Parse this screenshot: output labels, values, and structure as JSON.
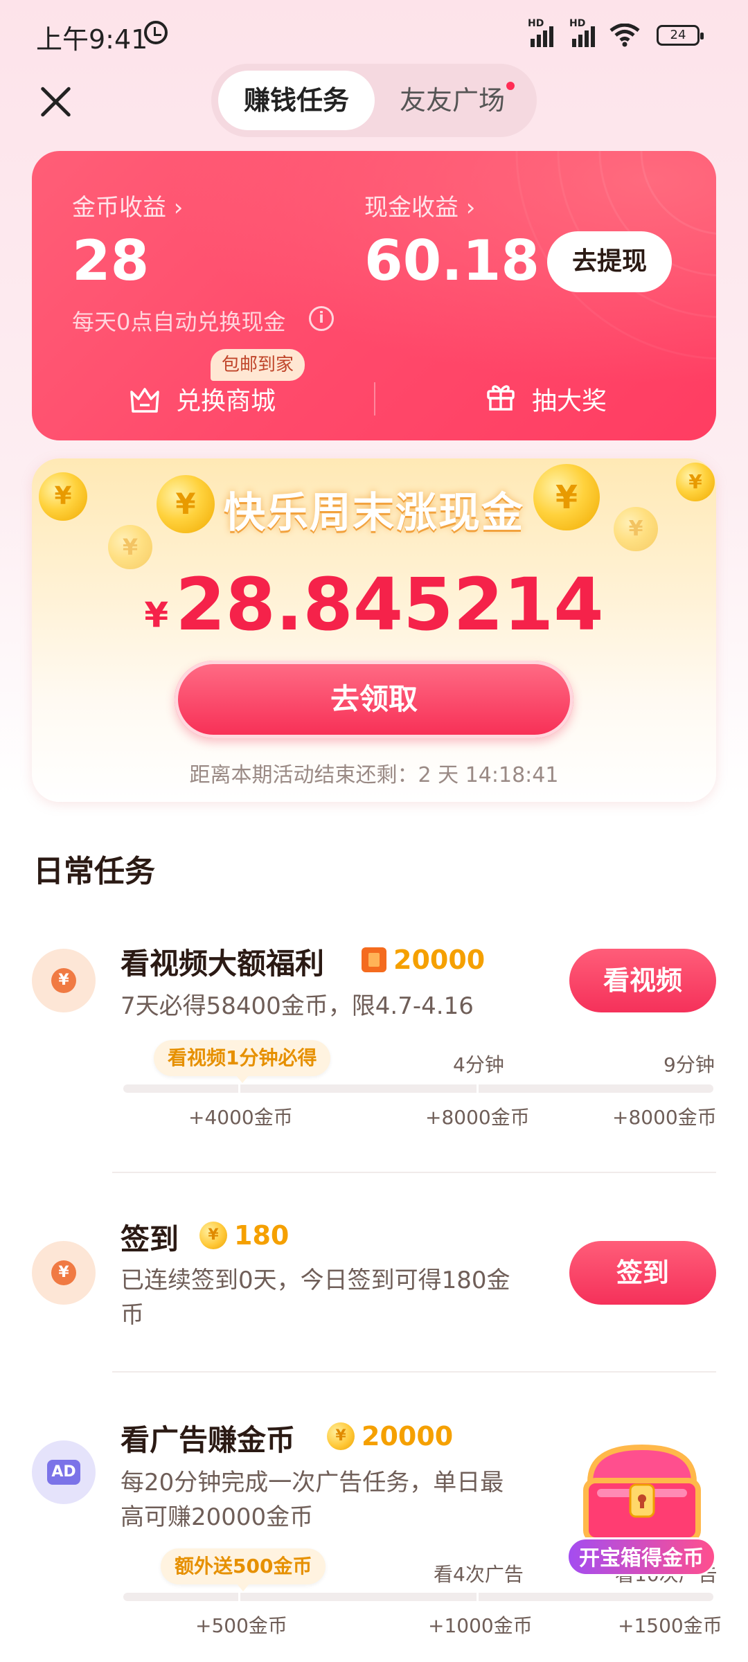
{
  "status_bar": {
    "time": "上午9:41",
    "battery": "24",
    "hd1": "HD",
    "hd2": "HD"
  },
  "header": {
    "tabs": [
      {
        "label": "赚钱任务",
        "active": true
      },
      {
        "label": "友友广场",
        "active": false
      }
    ]
  },
  "earnings": {
    "coin_label": "金币收益 ›",
    "coin_value": "28",
    "cash_label": "现金收益 ›",
    "cash_value": "60.18",
    "withdraw_label": "去提现",
    "note": "每天0点自动兑换现金",
    "badge": "包邮到家",
    "shop_label": "兑换商城",
    "lottery_label": "抽大奖"
  },
  "promo": {
    "title": "快乐周末涨现金",
    "currency": "¥",
    "amount": "28.845214",
    "claim_label": "去领取",
    "countdown": "距离本期活动结束还剩：2 天 14:18:41"
  },
  "daily": {
    "title": "日常任务",
    "tasks": [
      {
        "name": "看视频大额福利",
        "reward": "20000",
        "desc": "7天必得58400金币，限4.7-4.16",
        "button": "看视频",
        "tip": "看视频1分钟必得",
        "milestones_top": [
          "4分钟",
          "9分钟"
        ],
        "milestones_bottom": [
          "+4000金币",
          "+8000金币",
          "+8000金币"
        ]
      },
      {
        "name": "签到",
        "reward": "180",
        "desc_line1": "已连续签到0天，今日签到可得180金",
        "desc_line2": "币",
        "button": "签到"
      },
      {
        "name": "看广告赚金币",
        "reward": "20000",
        "icon_text": "AD",
        "desc_line1": "每20分钟完成一次广告任务，单日最",
        "desc_line2": "高可赚20000金币",
        "tip": "额外送500金币",
        "milestones_top": [
          "看4次广告",
          "看10次广告"
        ],
        "milestones_bottom": [
          "+500金币",
          "+1000金币",
          "+1500金币"
        ]
      }
    ]
  },
  "chest": {
    "label": "开宝箱得金币"
  },
  "colors": {
    "primary": "#f5315a",
    "gold": "#f5a000",
    "card": "#ff4a6b"
  }
}
